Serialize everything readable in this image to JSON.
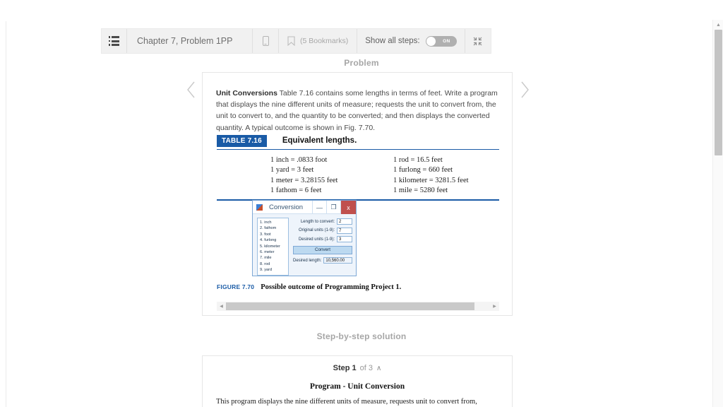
{
  "toolbar": {
    "menu_icon": "list-icon",
    "title": "Chapter 7, Problem 1PP",
    "device_icon": "mobile-device-icon",
    "bookmark_icon": "bookmark-icon",
    "bookmarks_label": "(5 Bookmarks)",
    "show_all_steps_label": "Show all steps:",
    "toggle_state": "ON",
    "collapse_icon": "collapse-icon"
  },
  "sections": {
    "problem_label": "Problem",
    "steps_label": "Step-by-step solution"
  },
  "nav": {
    "prev_icon": "chevron-left-icon",
    "next_icon": "chevron-right-icon"
  },
  "problem": {
    "lead": "Unit Conversions",
    "text": " Table 7.16 contains some lengths in terms of feet. Write a program that displays the nine different units of measure; requests the unit to convert from, the unit to convert to, and the quantity to be converted; and then displays the converted quantity. A typical outcome is shown in Fig. 7.70."
  },
  "table": {
    "badge": "TABLE 7.16",
    "caption": "Equivalent lengths.",
    "accent_color": "#1a5ba6",
    "left_column": [
      "1 inch  =  .0833 foot",
      "1 yard  =  3 feet",
      "1 meter  =  3.28155 feet",
      "1 fathom  =  6 feet"
    ],
    "right_column": [
      "1 rod  =  16.5 feet",
      "1 furlong  =  660 feet",
      "1 kilometer  =  3281.5 feet",
      "1 mile  =  5280 feet"
    ]
  },
  "dialog": {
    "app_icon": "windows-app-icon",
    "title": "Conversion",
    "minimize_label": "—",
    "maximize_label": "❐",
    "close_label": "x",
    "unit_list": [
      "1. inch",
      "2. fathom",
      "3. foot",
      "4. furlong",
      "5. kilometer",
      "6. meter",
      "7. mile",
      "8. rod",
      "9. yard"
    ],
    "fields": [
      {
        "label": "Length to convert:",
        "value": "2"
      },
      {
        "label": "Original units (1-9):",
        "value": "7"
      },
      {
        "label": "Desired units (1-9):",
        "value": "3"
      }
    ],
    "convert_button": "Convert",
    "result_label": "Desired length:",
    "result_value": "10,560.00"
  },
  "figure": {
    "number": "FIGURE 7.70",
    "caption": "Possible outcome of Programming Project 1."
  },
  "hscroll": {
    "left_arrow": "scroll-left-arrow",
    "right_arrow": "scroll-right-arrow"
  },
  "vscroll": {
    "up_arrow": "scroll-up-arrow"
  },
  "step": {
    "num_label": "Step 1",
    "of_label": "of 3",
    "chevron": "∧",
    "title": "Program -  Unit Conversion",
    "body": "This program displays the nine different units of measure, requests unit to convert from,"
  }
}
